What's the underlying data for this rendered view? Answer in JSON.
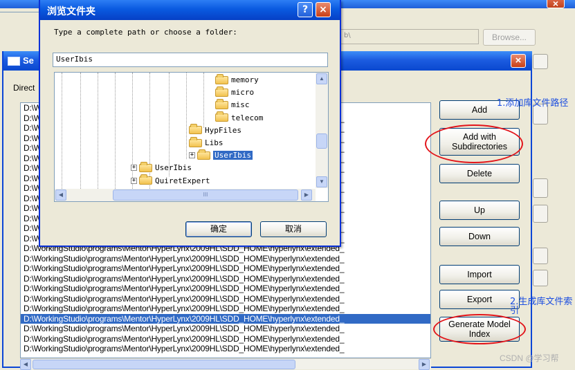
{
  "background_window": {
    "path_fragment": "b\\",
    "browse_label": "Browse..."
  },
  "main_dialog": {
    "title": "Se",
    "directory_label": "Direct",
    "paths": [
      "D:\\WorkingStudio\\programs\\Mentor\\HyperLynx\\2009HL\\SDD_HOME\\hyperlynx\\LIBS\\",
      "D:\\WorkingStudio\\programs\\Mentor\\HyperLynx\\2009HL\\SDD_HOME\\hyperlynx\\extended_",
      "D:\\WorkingStudio\\programs\\Mentor\\HyperLynx\\2009HL\\SDD_HOME\\hyperlynx\\extended_",
      "D:\\WorkingStudio\\programs\\Mentor\\HyperLynx\\2009HL\\SDD_HOME\\hyperlynx\\extended_",
      "D:\\WorkingStudio\\programs\\Mentor\\HyperLynx\\2009HL\\SDD_HOME\\hyperlynx\\extended_",
      "D:\\WorkingStudio\\programs\\Mentor\\HyperLynx\\2009HL\\SDD_HOME\\hyperlynx\\extended_",
      "D:\\WorkingStudio\\programs\\Mentor\\HyperLynx\\2009HL\\SDD_HOME\\hyperlynx\\extended_",
      "D:\\WorkingStudio\\programs\\Mentor\\HyperLynx\\2009HL\\SDD_HOME\\hyperlynx\\extended_",
      "D:\\WorkingStudio\\programs\\Mentor\\HyperLynx\\2009HL\\SDD_HOME\\hyperlynx\\extended_",
      "D:\\WorkingStudio\\programs\\Mentor\\HyperLynx\\2009HL\\SDD_HOME\\hyperlynx\\extended_",
      "D:\\WorkingStudio\\programs\\Mentor\\HyperLynx\\2009HL\\SDD_HOME\\hyperlynx\\extended_",
      "D:\\WorkingStudio\\programs\\Mentor\\HyperLynx\\2009HL\\SDD_HOME\\hyperlynx\\extended_",
      "D:\\WorkingStudio\\programs\\Mentor\\HyperLynx\\2009HL\\SDD_HOME\\hyperlynx\\extended_",
      "D:\\WorkingStudio\\programs\\Mentor\\HyperLynx\\2009HL\\SDD_HOME\\hyperlynx\\extended_",
      "D:\\WorkingStudio\\programs\\Mentor\\HyperLynx\\2009HL\\SDD_HOME\\hyperlynx\\extended_",
      "D:\\WorkingStudio\\programs\\Mentor\\HyperLynx\\2009HL\\SDD_HOME\\hyperlynx\\extended_",
      "D:\\WorkingStudio\\programs\\Mentor\\HyperLynx\\2009HL\\SDD_HOME\\hyperlynx\\extended_",
      "D:\\WorkingStudio\\programs\\Mentor\\HyperLynx\\2009HL\\SDD_HOME\\hyperlynx\\extended_",
      "D:\\WorkingStudio\\programs\\Mentor\\HyperLynx\\2009HL\\SDD_HOME\\hyperlynx\\extended_",
      "D:\\WorkingStudio\\programs\\Mentor\\HyperLynx\\2009HL\\SDD_HOME\\hyperlynx\\extended_",
      "D:\\WorkingStudio\\programs\\Mentor\\HyperLynx\\2009HL\\SDD_HOME\\hyperlynx\\extended_",
      "D:\\WorkingStudio\\programs\\Mentor\\HyperLynx\\2009HL\\SDD_HOME\\hyperlynx\\extended_",
      "D:\\WorkingStudio\\programs\\Mentor\\HyperLynx\\2009HL\\SDD_HOME\\hyperlynx\\extended_",
      "D:\\WorkingStudio\\programs\\Mentor\\HyperLynx\\2009HL\\SDD_HOME\\hyperlynx\\extended_",
      "D:\\WorkingStudio\\programs\\Mentor\\HyperLynx\\2009HL\\SDD_HOME\\hyperlynx\\extended_"
    ],
    "selected_index": 21,
    "buttons": {
      "add": "Add",
      "add_with_subdirs": "Add with Subdirectories",
      "delete": "Delete",
      "up": "Up",
      "down": "Down",
      "import": "Import",
      "export": "Export",
      "generate_index": "Generate Model Index"
    }
  },
  "annotations": {
    "step1": "1.添加库文件路径",
    "step2": "2.生成库文件索引"
  },
  "browse_dialog": {
    "title": "浏览文件夹",
    "help_glyph": "?",
    "close_glyph": "×",
    "instruction": "Type a complete path or choose a folder:",
    "path_value": "UserIbis",
    "tree": [
      {
        "label": "memory",
        "indent": 4,
        "expander": "",
        "selected": false
      },
      {
        "label": "micro",
        "indent": 4,
        "expander": "",
        "selected": false
      },
      {
        "label": "misc",
        "indent": 4,
        "expander": "",
        "selected": false
      },
      {
        "label": "telecom",
        "indent": 4,
        "expander": "",
        "selected": false
      },
      {
        "label": "HypFiles",
        "indent": 3,
        "expander": "",
        "selected": false
      },
      {
        "label": "Libs",
        "indent": 3,
        "expander": "",
        "selected": false
      },
      {
        "label": "UserIbis",
        "indent": 3,
        "expander": "+",
        "selected": true
      },
      {
        "label": "UserIbis",
        "indent": 2,
        "expander": "+",
        "selected": false
      },
      {
        "label": "QuiretExpert",
        "indent": 2,
        "expander": "+",
        "selected": false
      }
    ],
    "ok_label": "确定",
    "cancel_label": "取消"
  },
  "watermark": "CSDN @学习帮"
}
